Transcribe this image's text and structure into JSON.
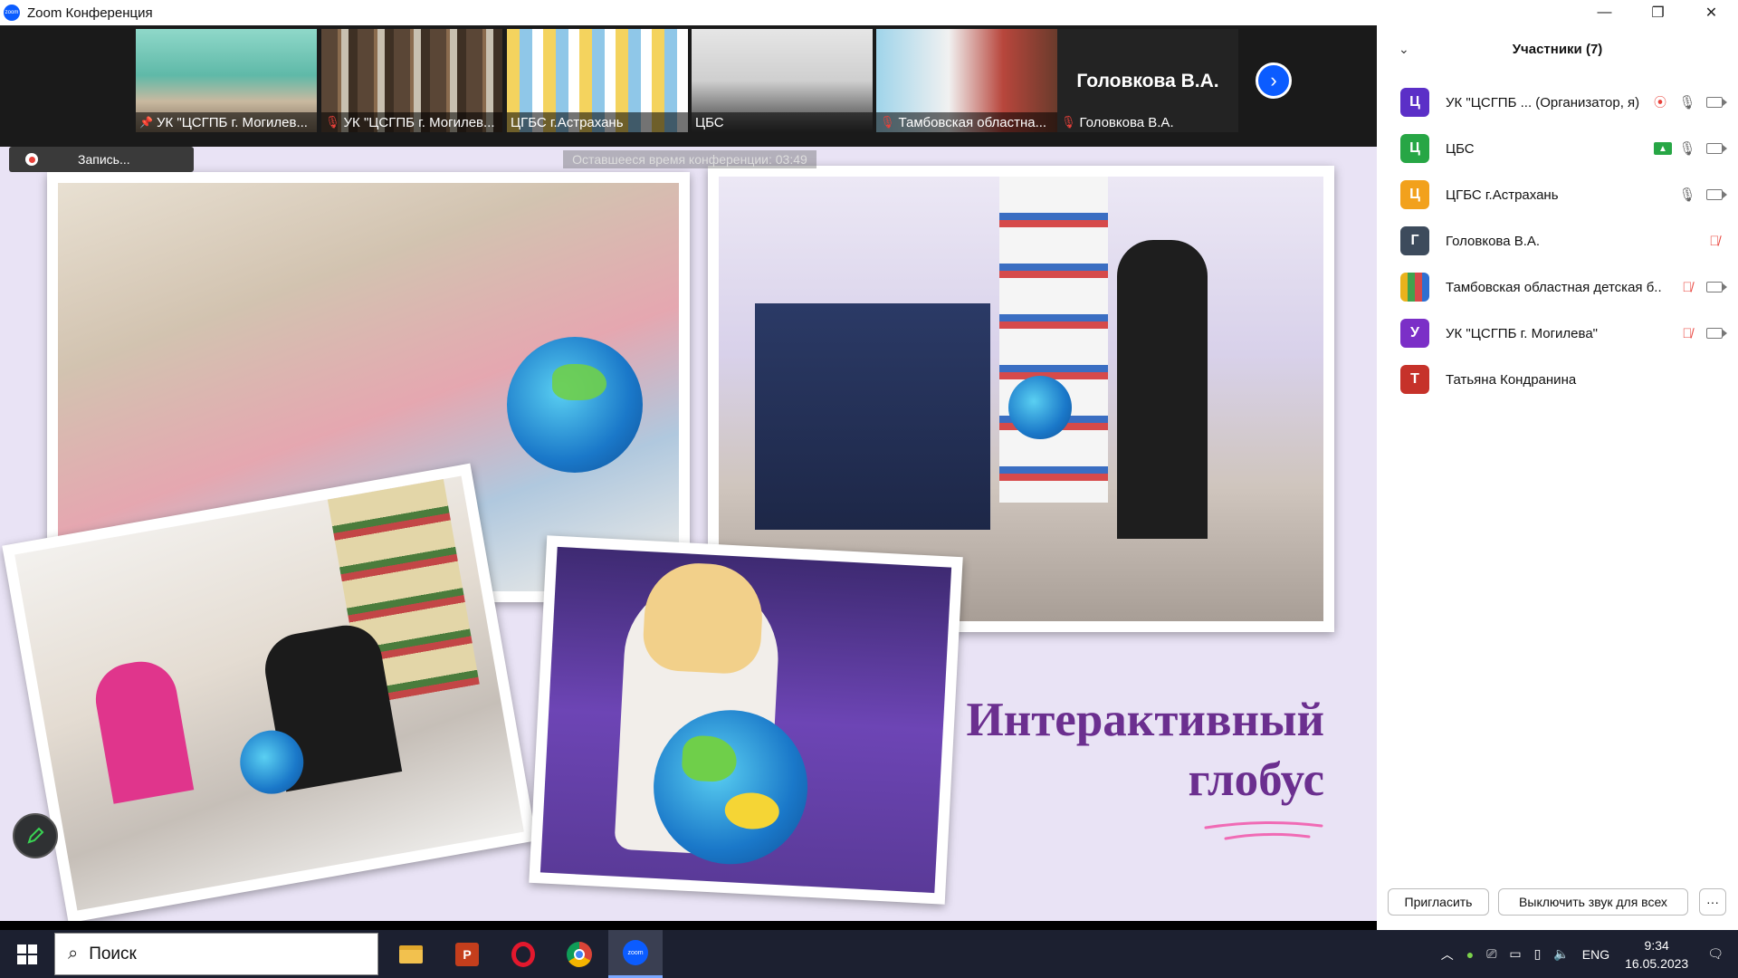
{
  "window": {
    "title": "Zoom Конференция",
    "app_icon_text": "zoom",
    "controls": [
      "—",
      "❐",
      "✕"
    ]
  },
  "video_strip": {
    "tiles": [
      {
        "label": "УК \"ЦСГПБ г. Могилев...",
        "status": "pinned"
      },
      {
        "label": "УК \"ЦСГПБ г. Могилев...",
        "status": "muted"
      },
      {
        "label": "ЦГБС г.Астрахань",
        "status": "none"
      },
      {
        "label": "ЦБС",
        "status": "none"
      },
      {
        "label": "Тамбовская областна...",
        "status": "muted"
      },
      {
        "label": "Головкова В.А.",
        "status": "muted"
      }
    ],
    "name_tile": {
      "big_name": "Головкова В.А.",
      "label": "Головкова В.А."
    },
    "next_icon": "chevron-right-icon"
  },
  "recording": {
    "label": "Запись..."
  },
  "timer": {
    "text": "Оставшееся время конференции: 03:49"
  },
  "slide": {
    "title_line1": "Интерактивный",
    "title_line2": "глобус",
    "accent_color": "#6b2f8f",
    "underline_color": "#f06bb5"
  },
  "panel": {
    "header": "Участники (7)",
    "participants": [
      {
        "initial": "Ц",
        "name": "УК \"ЦСГПБ ...  (Организатор, я)",
        "color": "#5b2fc7",
        "icons": [
          "record",
          "mic",
          "cam"
        ]
      },
      {
        "initial": "Ц",
        "name": "ЦБС",
        "color": "#27a645",
        "icons": [
          "share",
          "mic",
          "cam"
        ]
      },
      {
        "initial": "Ц",
        "name": "ЦГБС г.Астрахань",
        "color": "#f2a11c",
        "icons": [
          "mic",
          "cam"
        ]
      },
      {
        "initial": "Г",
        "name": "Головкова В.А.",
        "color": "#3d4b5c",
        "icons": [
          "mic-off"
        ]
      },
      {
        "initial": "",
        "name": "Тамбовская областная детская б...",
        "color": "#e9b21c",
        "icons": [
          "mic-off",
          "cam"
        ]
      },
      {
        "initial": "У",
        "name": "УК \"ЦСГПБ г. Могилева\"",
        "color": "#7b2fc7",
        "icons": [
          "mic-off",
          "cam"
        ]
      },
      {
        "initial": "Т",
        "name": "Татьяна Кондранина",
        "color": "#c6322a",
        "icons": []
      }
    ],
    "invite_label": "Пригласить",
    "mute_all_label": "Выключить звук для всех",
    "more_label": "···"
  },
  "taskbar": {
    "search_placeholder": "Поиск",
    "language": "ENG",
    "time": "9:34",
    "date": "16.05.2023"
  }
}
